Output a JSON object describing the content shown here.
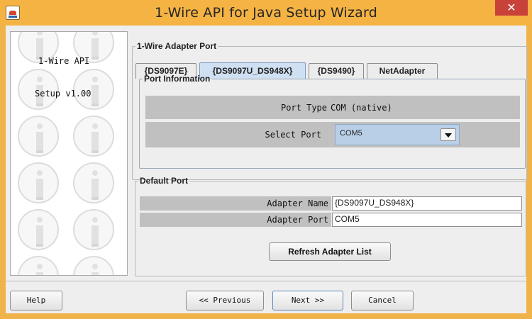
{
  "window": {
    "title": "1-Wire API for Java Setup Wizard",
    "close_glyph": "✕",
    "app_icon": "java-app-icon",
    "titlebar_color": "#f4b343",
    "close_color": "#c8423a"
  },
  "side_panel": {
    "line1": "1-Wire API",
    "line2": "Setup v1.00",
    "watermark_icon": "info-i-icon"
  },
  "adapter_port": {
    "legend": "1-Wire Adapter Port",
    "tabs": [
      {
        "label": "{DS9097E}",
        "active": false
      },
      {
        "label": "{DS9097U_DS948X}",
        "active": true
      },
      {
        "label": "{DS9490}",
        "active": false
      },
      {
        "label": "NetAdapter",
        "active": false
      }
    ],
    "port_info": {
      "legend": "Port Information",
      "port_type_label": "Port Type",
      "port_type_value": "COM (native)",
      "select_port_label": "Select Port",
      "select_port_value": "COM5"
    }
  },
  "default_port": {
    "legend": "Default Port",
    "adapter_name_label": "Adapter Name",
    "adapter_name_value": "{DS9097U_DS948X}",
    "adapter_port_label": "Adapter Port",
    "adapter_port_value": "COM5",
    "refresh_label": "Refresh Adapter List"
  },
  "footer": {
    "help_label": "Help",
    "previous_label": "<< Previous",
    "next_label": "Next >>",
    "cancel_label": "Cancel"
  }
}
